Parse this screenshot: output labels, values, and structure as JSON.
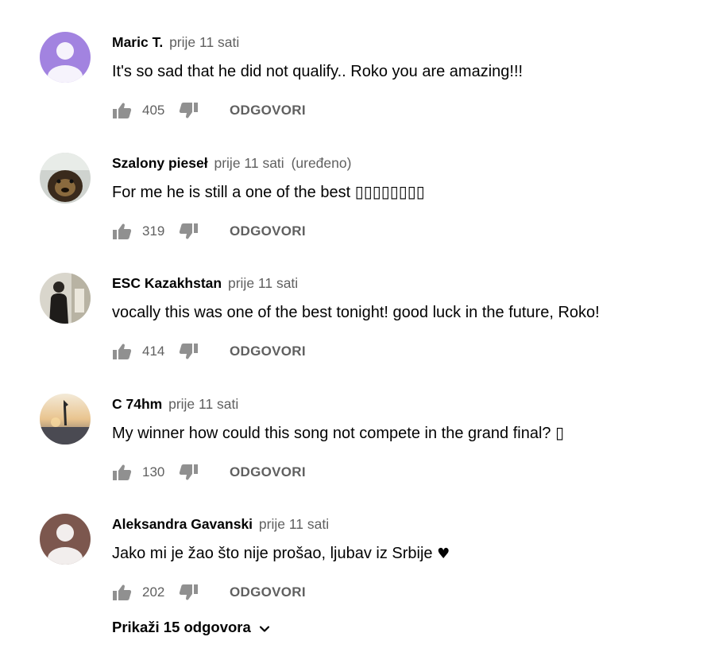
{
  "comments": [
    {
      "author": "Maric T.",
      "time": "prije 11 sati",
      "edited": "",
      "text": "It's so sad that he did not qualify.. Roko you are amazing!!!",
      "likes": "405",
      "reply_label": "ODGOVORI",
      "avatar": "default-avatar-purple-icon",
      "avatar_bg": "#a283e0"
    },
    {
      "author": "Szalony pieseł",
      "time": "prije 11 sati",
      "edited": "(uređeno)",
      "text": "For me he is still a one of the best ▯▯▯▯▯▯▯▯",
      "likes": "319",
      "reply_label": "ODGOVORI",
      "avatar": "dog-photo-avatar-icon"
    },
    {
      "author": "ESC Kazakhstan",
      "time": "prije 11 sati",
      "edited": "",
      "text": "vocally this was one of the best tonight! good luck in the future, Roko!",
      "likes": "414",
      "reply_label": "ODGOVORI",
      "avatar": "person-photo-avatar-icon"
    },
    {
      "author": "C 74hm",
      "time": "prije 11 sati",
      "edited": "",
      "text": "My winner how could this song not compete in the grand final? ▯",
      "likes": "130",
      "reply_label": "ODGOVORI",
      "avatar": "sunset-photo-avatar-icon"
    },
    {
      "author": "Aleksandra Gavanski",
      "time": "prije 11 sati",
      "edited": "",
      "text": "Jako mi je žao što nije prošao, ljubav iz Srbije",
      "text_suffix": "♥",
      "likes": "202",
      "reply_label": "ODGOVORI",
      "avatar": "default-avatar-brown-icon",
      "avatar_bg": "#7c574e"
    }
  ],
  "replies_toggle": "Prikaži 15 odgovora",
  "icons": {
    "like": "thumbs-up-icon",
    "dislike": "thumbs-down-icon",
    "expand": "chevron-down-icon"
  },
  "colors": {
    "text": "#030303",
    "secondary": "#606060",
    "icon": "#909090"
  }
}
